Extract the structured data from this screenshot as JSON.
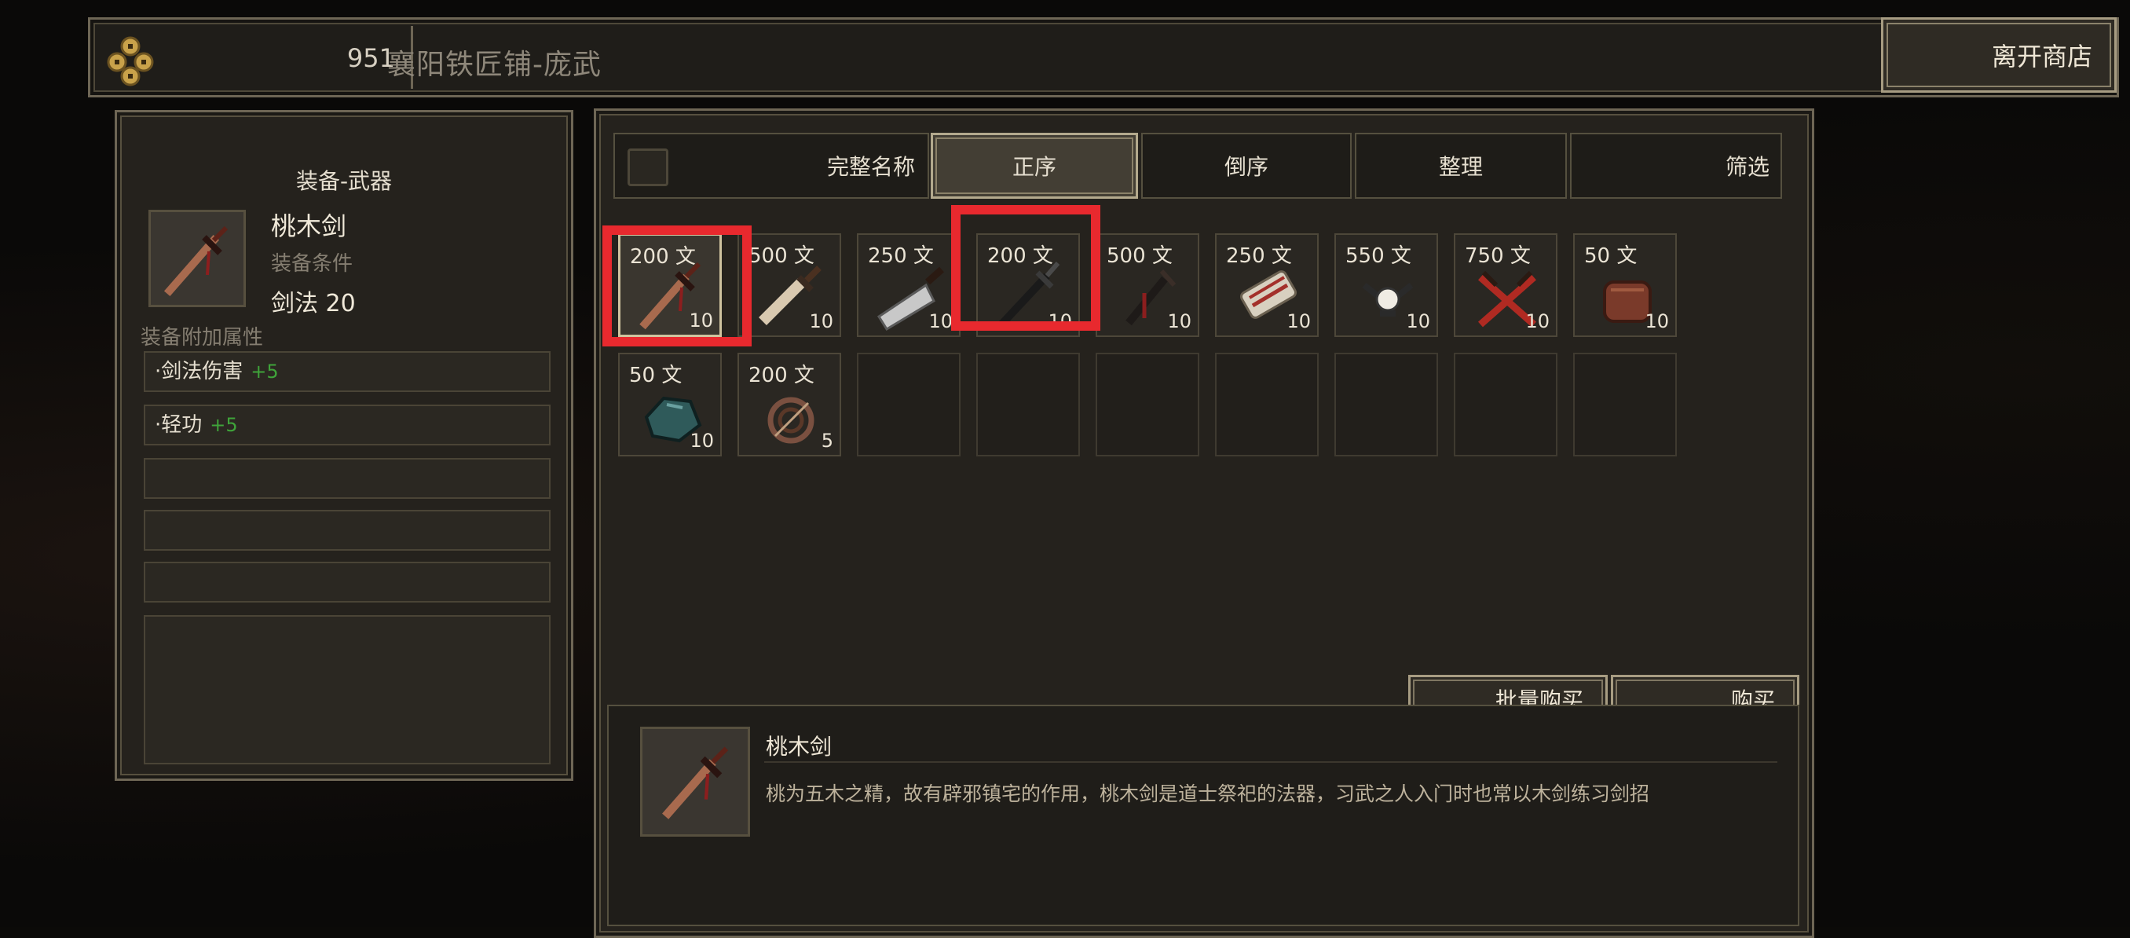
{
  "top": {
    "money": "951",
    "shop_title": "襄阳铁匠铺-庞武",
    "leave_label": "离开商店"
  },
  "detail": {
    "heading": "装备-武器",
    "name": "桃木剑",
    "condition_label": "装备条件",
    "requirement": "剑法 20",
    "attr_label": "装备附加属性",
    "attrs": [
      {
        "name": "·剑法伤害",
        "value": "+5"
      },
      {
        "name": "·轻功",
        "value": "+5"
      }
    ]
  },
  "tabs": {
    "full_name": "完整名称",
    "asc": "正序",
    "desc": "倒序",
    "organize": "整理",
    "filter": "筛选"
  },
  "items": [
    {
      "price": "200 文",
      "qty": "10",
      "icon": "peach-wood-sword-icon"
    },
    {
      "price": "500 文",
      "qty": "10",
      "icon": "dagger-icon"
    },
    {
      "price": "250 文",
      "qty": "10",
      "icon": "broadsword-icon"
    },
    {
      "price": "200 文",
      "qty": "10",
      "icon": "dark-sword-icon"
    },
    {
      "price": "500 文",
      "qty": "10",
      "icon": "short-sword-icon"
    },
    {
      "price": "250 文",
      "qty": "10",
      "icon": "scroll-icon"
    },
    {
      "price": "550 文",
      "qty": "10",
      "icon": "claw-icon"
    },
    {
      "price": "750 文",
      "qty": "10",
      "icon": "crossed-blades-icon"
    },
    {
      "price": "50 文",
      "qty": "10",
      "icon": "leather-icon"
    },
    {
      "price": "50 文",
      "qty": "10",
      "icon": "ore-icon"
    },
    {
      "price": "200 文",
      "qty": "5",
      "icon": "rope-coil-icon"
    }
  ],
  "buttons": {
    "bulk_buy": "批量购买",
    "buy": "购买"
  },
  "description": {
    "name": "桃木剑",
    "text": "桃为五木之精，故有辟邪镇宅的作用，桃木剑是道士祭祀的法器，习武之人入门时也常以木剑练习剑招"
  },
  "colors": {
    "highlight": "#e8292e",
    "bonus": "#3fa43a",
    "frame": "#6e6655"
  }
}
